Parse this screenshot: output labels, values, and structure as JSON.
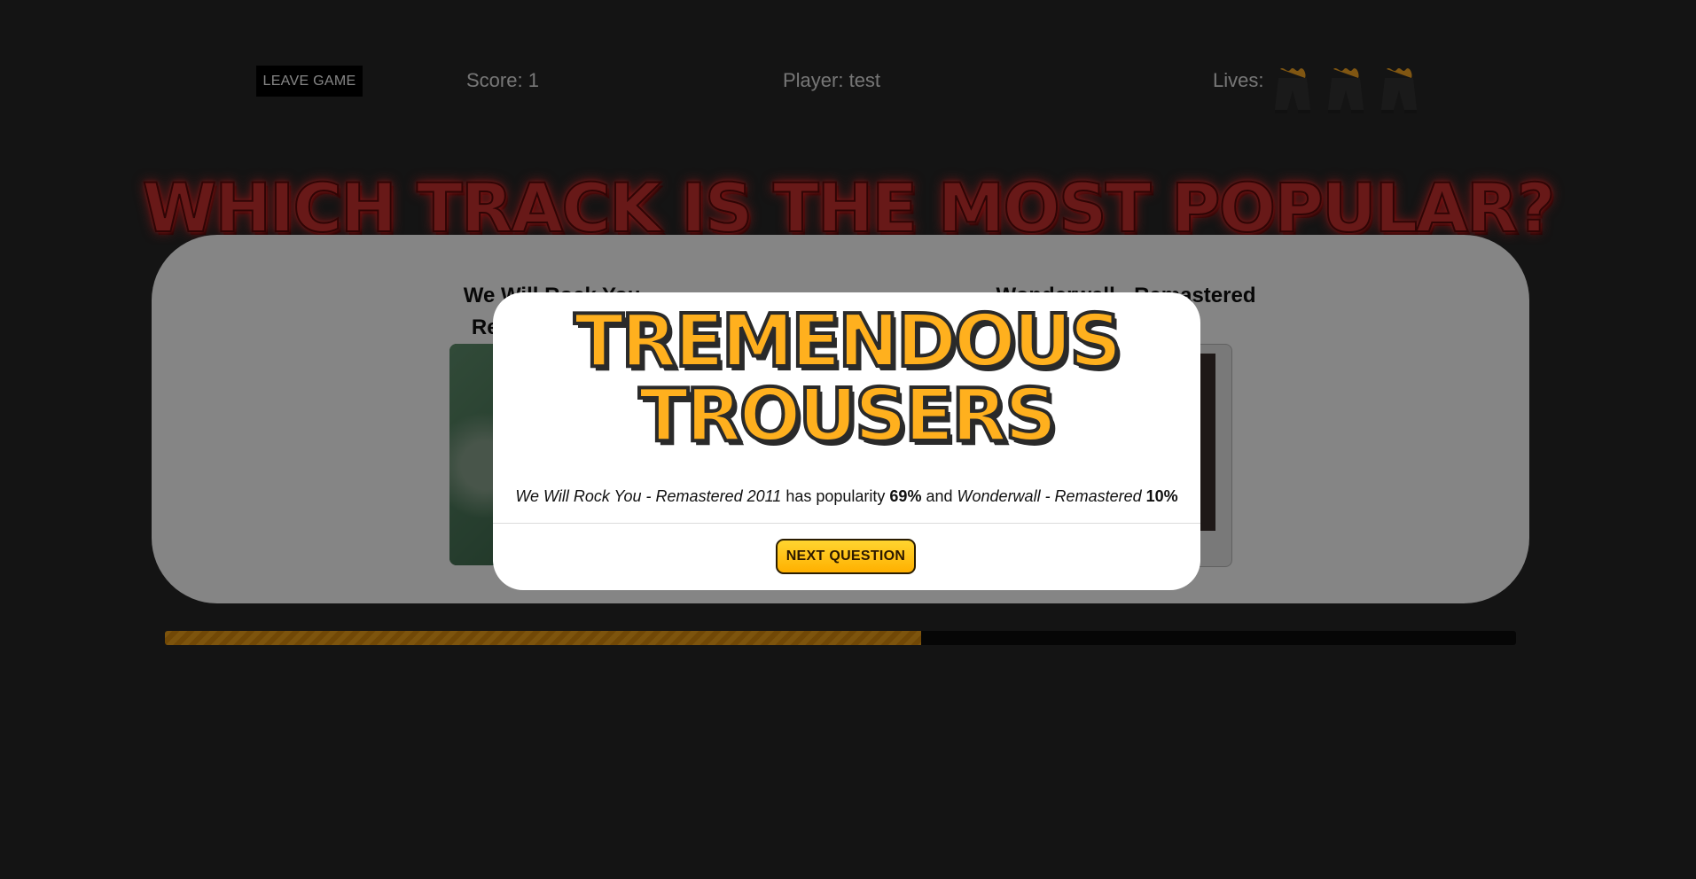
{
  "header": {
    "leave_label": "LEAVE GAME",
    "score_text": "Score: 1",
    "player_text": "Player: test",
    "lives_label": "Lives:",
    "lives_count": 3,
    "life_icon": "flaming-trousers-icon"
  },
  "question": {
    "title": "WHICH TRACK  IS THE MOST POPULAR?",
    "option_a_title": "We Will Rock You - Remastered 2011",
    "option_b_title": "Wonderwall - Remastered"
  },
  "progress": {
    "fraction": 0.56,
    "color": "#f0a21a"
  },
  "result": {
    "heading_line1": "TREMENDOUS",
    "heading_line2": "TROUSERS",
    "track_a": "We Will Rock You - Remastered 2011",
    "has_popularity": "has popularity",
    "popularity_a": "69%",
    "and": "and",
    "track_b": "Wonderwall - Remastered",
    "popularity_b": "10%",
    "next_label": "NEXT QUESTION"
  },
  "colors": {
    "background": "#272727",
    "title_red": "#c8302e",
    "accent_orange": "#ffb01e",
    "button_yellow": "#ffd530"
  }
}
